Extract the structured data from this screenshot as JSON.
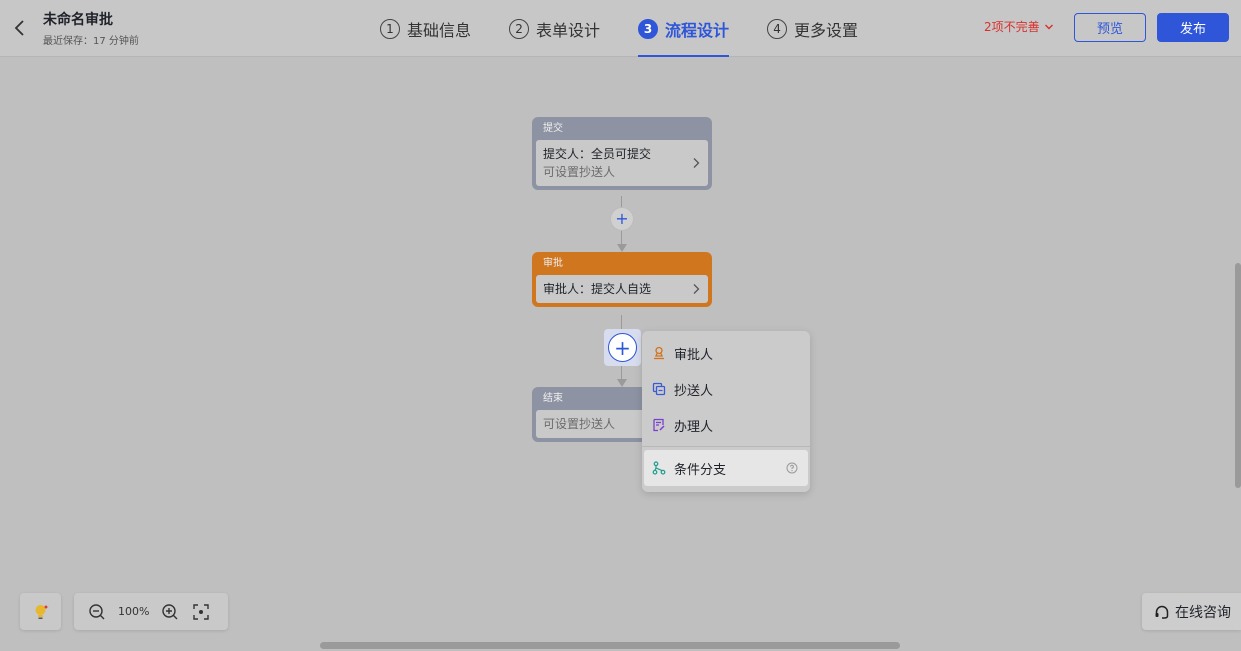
{
  "header": {
    "title": "未命名审批",
    "last_saved": "最近保存：17 分钟前",
    "steps": [
      {
        "num": "1",
        "label": "基础信息",
        "active": false
      },
      {
        "num": "2",
        "label": "表单设计",
        "active": false
      },
      {
        "num": "3",
        "label": "流程设计",
        "active": true
      },
      {
        "num": "4",
        "label": "更多设置",
        "active": false
      }
    ],
    "incomplete_label": "2项不完善",
    "preview_label": "预览",
    "publish_label": "发布"
  },
  "flow": {
    "submit_node": {
      "title": "提交",
      "line1": "提交人：全员可提交",
      "line2": "可设置抄送人"
    },
    "approve_node": {
      "title": "审批",
      "line1": "审批人：提交人自选"
    },
    "end_node": {
      "title": "结束",
      "line1": "可设置抄送人"
    }
  },
  "add_menu": {
    "items": [
      {
        "label": "审批人",
        "icon": "approver-icon"
      },
      {
        "label": "抄送人",
        "icon": "cc-icon"
      },
      {
        "label": "办理人",
        "icon": "handler-icon"
      },
      {
        "label": "条件分支",
        "icon": "branch-icon"
      }
    ]
  },
  "toolbar": {
    "zoom": "100%"
  },
  "consult_label": "在线咨询",
  "colors": {
    "accent": "#2f56d8",
    "approve_node": "#cf761f",
    "submit_node": "#8d93a3",
    "warning": "#d9302c"
  }
}
